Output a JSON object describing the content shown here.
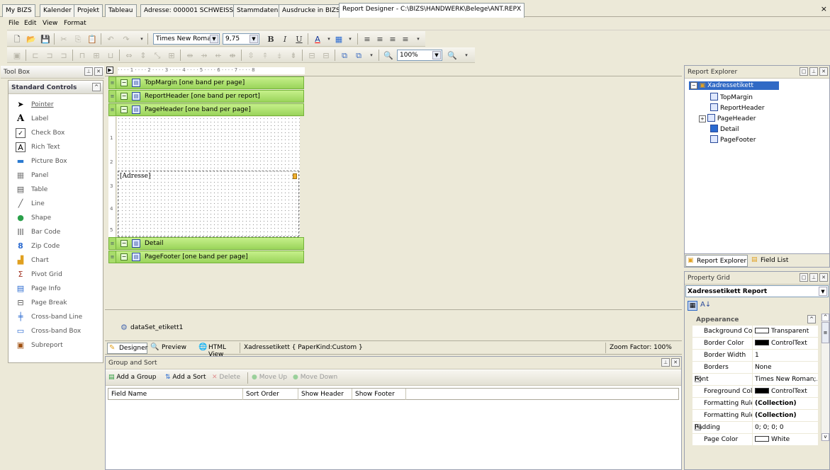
{
  "tabs": [
    "My BIZS",
    "Kalender",
    "Projekt",
    "Tableau",
    "Adresse: 000001 SCHWEISS",
    "Stammdaten",
    "Ausdrucke in BIZS",
    "Report Designer - C:\\BIZS\\HANDWERK\\Belege\\ANT.REPX"
  ],
  "close_glyph": "×",
  "menu": [
    "File",
    "Edit",
    "View",
    "Format"
  ],
  "font_name": "Times New Roman",
  "font_size": "9,75",
  "format_buttons": [
    "B",
    "I",
    "U"
  ],
  "zoom_combo": "100%",
  "toolbox": {
    "title": "Tool Box",
    "section": "Standard Controls",
    "items": [
      "Pointer",
      "Label",
      "Check Box",
      "Rich Text",
      "Picture Box",
      "Panel",
      "Table",
      "Line",
      "Shape",
      "Bar Code",
      "Zip Code",
      "Chart",
      "Pivot Grid",
      "Page Info",
      "Page Break",
      "Cross-band Line",
      "Cross-band Box",
      "Subreport"
    ]
  },
  "ruler_text": "· · · · 1 · · · · 2 · · · · 3 · · · · 4 · · · · 5 · · · · 6 · · · · 7 · · · · 8",
  "vruler": [
    "1",
    "2",
    "3",
    "4",
    "5"
  ],
  "bands": {
    "top_margin": "TopMargin [one band per page]",
    "report_header": "ReportHeader [one band per report]",
    "page_header": "PageHeader [one band per page]",
    "detail": "Detail",
    "page_footer": "PageFooter [one band per page]"
  },
  "address_field": "[Adresse]",
  "component": "dataSet_etikett1",
  "view_tabs": {
    "designer": "Designer",
    "preview": "Preview",
    "html_view": "HTML View"
  },
  "status_report": "Xadressetikett { PaperKind:Custom }",
  "status_zoom": "Zoom Factor: 100%",
  "group_sort": {
    "title": "Group and Sort",
    "buttons": [
      "Add a Group",
      "Add a Sort",
      "Delete",
      "Move Up",
      "Move Down"
    ],
    "columns": [
      "Field Name",
      "Sort Order",
      "Show Header",
      "Show Footer"
    ]
  },
  "report_explorer": {
    "title": "Report Explorer",
    "root": "Xadressetikett",
    "children": [
      "TopMargin",
      "ReportHeader",
      "PageHeader",
      "Detail",
      "PageFooter"
    ],
    "tabs": [
      "Report Explorer",
      "Field List"
    ]
  },
  "property_grid": {
    "title": "Property Grid",
    "object": "Xadressetikett  Report",
    "category": "Appearance",
    "rows": [
      {
        "name": "Background Colo",
        "value": "Transparent",
        "swatch": "#ffffff"
      },
      {
        "name": "Border Color",
        "value": "ControlText",
        "swatch": "#000000"
      },
      {
        "name": "Border Width",
        "value": "1"
      },
      {
        "name": "Borders",
        "value": "None"
      },
      {
        "name": "Font",
        "value": "Times New Roman;...",
        "expander": true
      },
      {
        "name": "Foreground Colo",
        "value": "ControlText",
        "swatch": "#000000"
      },
      {
        "name": "Formatting Rule",
        "value": "(Collection)",
        "bold": true
      },
      {
        "name": "Formatting Rules",
        "value": "(Collection)",
        "bold": true
      },
      {
        "name": "Padding",
        "value": "0; 0; 0; 0",
        "expander": true
      },
      {
        "name": "Page Color",
        "value": "White",
        "swatch": "#ffffff"
      }
    ]
  },
  "colors": {
    "band_green": "#9ad45a",
    "selection": "#316ac5",
    "panel_border": "#9aa0b0"
  }
}
